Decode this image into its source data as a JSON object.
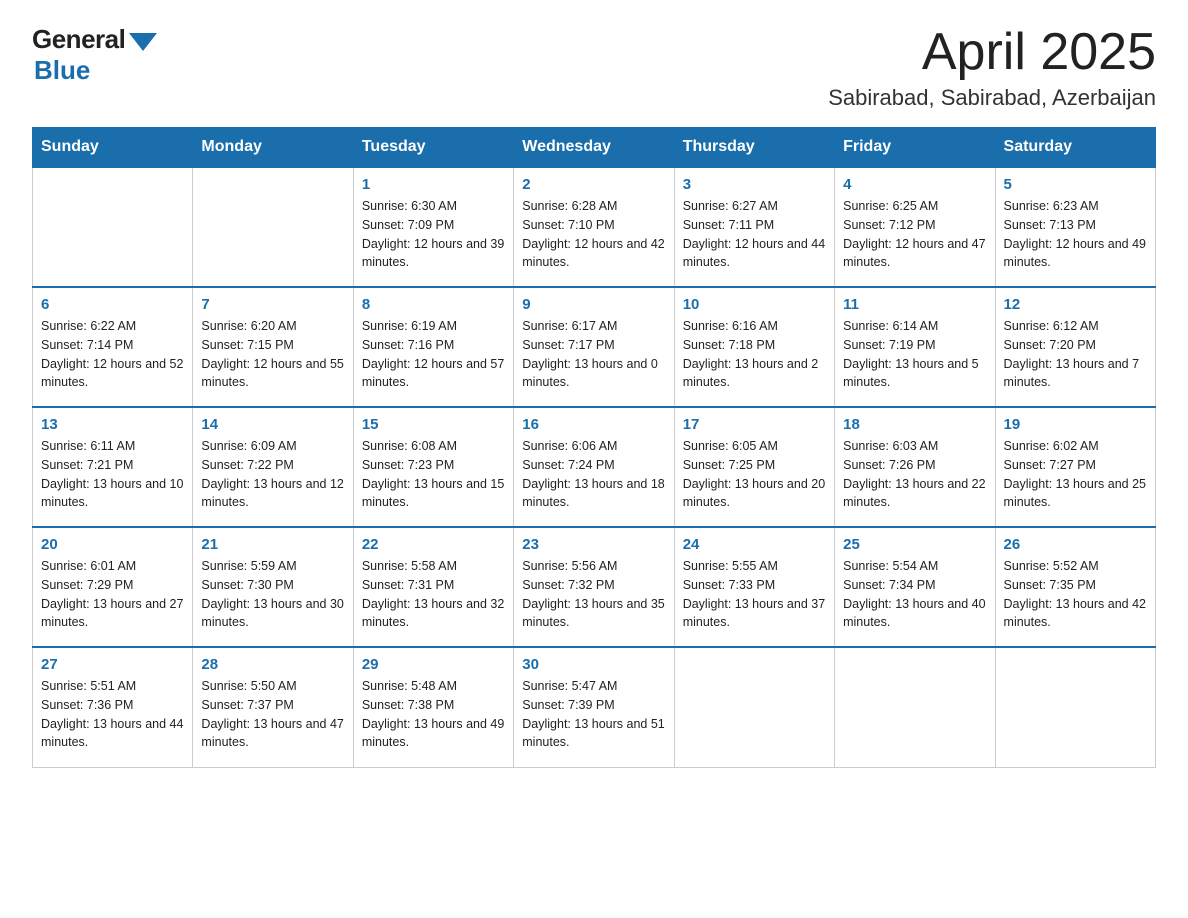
{
  "header": {
    "logo_general": "General",
    "logo_blue": "Blue",
    "month_title": "April 2025",
    "location": "Sabirabad, Sabirabad, Azerbaijan"
  },
  "weekdays": [
    "Sunday",
    "Monday",
    "Tuesday",
    "Wednesday",
    "Thursday",
    "Friday",
    "Saturday"
  ],
  "weeks": [
    [
      {
        "day": "",
        "sunrise": "",
        "sunset": "",
        "daylight": ""
      },
      {
        "day": "",
        "sunrise": "",
        "sunset": "",
        "daylight": ""
      },
      {
        "day": "1",
        "sunrise": "Sunrise: 6:30 AM",
        "sunset": "Sunset: 7:09 PM",
        "daylight": "Daylight: 12 hours and 39 minutes."
      },
      {
        "day": "2",
        "sunrise": "Sunrise: 6:28 AM",
        "sunset": "Sunset: 7:10 PM",
        "daylight": "Daylight: 12 hours and 42 minutes."
      },
      {
        "day": "3",
        "sunrise": "Sunrise: 6:27 AM",
        "sunset": "Sunset: 7:11 PM",
        "daylight": "Daylight: 12 hours and 44 minutes."
      },
      {
        "day": "4",
        "sunrise": "Sunrise: 6:25 AM",
        "sunset": "Sunset: 7:12 PM",
        "daylight": "Daylight: 12 hours and 47 minutes."
      },
      {
        "day": "5",
        "sunrise": "Sunrise: 6:23 AM",
        "sunset": "Sunset: 7:13 PM",
        "daylight": "Daylight: 12 hours and 49 minutes."
      }
    ],
    [
      {
        "day": "6",
        "sunrise": "Sunrise: 6:22 AM",
        "sunset": "Sunset: 7:14 PM",
        "daylight": "Daylight: 12 hours and 52 minutes."
      },
      {
        "day": "7",
        "sunrise": "Sunrise: 6:20 AM",
        "sunset": "Sunset: 7:15 PM",
        "daylight": "Daylight: 12 hours and 55 minutes."
      },
      {
        "day": "8",
        "sunrise": "Sunrise: 6:19 AM",
        "sunset": "Sunset: 7:16 PM",
        "daylight": "Daylight: 12 hours and 57 minutes."
      },
      {
        "day": "9",
        "sunrise": "Sunrise: 6:17 AM",
        "sunset": "Sunset: 7:17 PM",
        "daylight": "Daylight: 13 hours and 0 minutes."
      },
      {
        "day": "10",
        "sunrise": "Sunrise: 6:16 AM",
        "sunset": "Sunset: 7:18 PM",
        "daylight": "Daylight: 13 hours and 2 minutes."
      },
      {
        "day": "11",
        "sunrise": "Sunrise: 6:14 AM",
        "sunset": "Sunset: 7:19 PM",
        "daylight": "Daylight: 13 hours and 5 minutes."
      },
      {
        "day": "12",
        "sunrise": "Sunrise: 6:12 AM",
        "sunset": "Sunset: 7:20 PM",
        "daylight": "Daylight: 13 hours and 7 minutes."
      }
    ],
    [
      {
        "day": "13",
        "sunrise": "Sunrise: 6:11 AM",
        "sunset": "Sunset: 7:21 PM",
        "daylight": "Daylight: 13 hours and 10 minutes."
      },
      {
        "day": "14",
        "sunrise": "Sunrise: 6:09 AM",
        "sunset": "Sunset: 7:22 PM",
        "daylight": "Daylight: 13 hours and 12 minutes."
      },
      {
        "day": "15",
        "sunrise": "Sunrise: 6:08 AM",
        "sunset": "Sunset: 7:23 PM",
        "daylight": "Daylight: 13 hours and 15 minutes."
      },
      {
        "day": "16",
        "sunrise": "Sunrise: 6:06 AM",
        "sunset": "Sunset: 7:24 PM",
        "daylight": "Daylight: 13 hours and 18 minutes."
      },
      {
        "day": "17",
        "sunrise": "Sunrise: 6:05 AM",
        "sunset": "Sunset: 7:25 PM",
        "daylight": "Daylight: 13 hours and 20 minutes."
      },
      {
        "day": "18",
        "sunrise": "Sunrise: 6:03 AM",
        "sunset": "Sunset: 7:26 PM",
        "daylight": "Daylight: 13 hours and 22 minutes."
      },
      {
        "day": "19",
        "sunrise": "Sunrise: 6:02 AM",
        "sunset": "Sunset: 7:27 PM",
        "daylight": "Daylight: 13 hours and 25 minutes."
      }
    ],
    [
      {
        "day": "20",
        "sunrise": "Sunrise: 6:01 AM",
        "sunset": "Sunset: 7:29 PM",
        "daylight": "Daylight: 13 hours and 27 minutes."
      },
      {
        "day": "21",
        "sunrise": "Sunrise: 5:59 AM",
        "sunset": "Sunset: 7:30 PM",
        "daylight": "Daylight: 13 hours and 30 minutes."
      },
      {
        "day": "22",
        "sunrise": "Sunrise: 5:58 AM",
        "sunset": "Sunset: 7:31 PM",
        "daylight": "Daylight: 13 hours and 32 minutes."
      },
      {
        "day": "23",
        "sunrise": "Sunrise: 5:56 AM",
        "sunset": "Sunset: 7:32 PM",
        "daylight": "Daylight: 13 hours and 35 minutes."
      },
      {
        "day": "24",
        "sunrise": "Sunrise: 5:55 AM",
        "sunset": "Sunset: 7:33 PM",
        "daylight": "Daylight: 13 hours and 37 minutes."
      },
      {
        "day": "25",
        "sunrise": "Sunrise: 5:54 AM",
        "sunset": "Sunset: 7:34 PM",
        "daylight": "Daylight: 13 hours and 40 minutes."
      },
      {
        "day": "26",
        "sunrise": "Sunrise: 5:52 AM",
        "sunset": "Sunset: 7:35 PM",
        "daylight": "Daylight: 13 hours and 42 minutes."
      }
    ],
    [
      {
        "day": "27",
        "sunrise": "Sunrise: 5:51 AM",
        "sunset": "Sunset: 7:36 PM",
        "daylight": "Daylight: 13 hours and 44 minutes."
      },
      {
        "day": "28",
        "sunrise": "Sunrise: 5:50 AM",
        "sunset": "Sunset: 7:37 PM",
        "daylight": "Daylight: 13 hours and 47 minutes."
      },
      {
        "day": "29",
        "sunrise": "Sunrise: 5:48 AM",
        "sunset": "Sunset: 7:38 PM",
        "daylight": "Daylight: 13 hours and 49 minutes."
      },
      {
        "day": "30",
        "sunrise": "Sunrise: 5:47 AM",
        "sunset": "Sunset: 7:39 PM",
        "daylight": "Daylight: 13 hours and 51 minutes."
      },
      {
        "day": "",
        "sunrise": "",
        "sunset": "",
        "daylight": ""
      },
      {
        "day": "",
        "sunrise": "",
        "sunset": "",
        "daylight": ""
      },
      {
        "day": "",
        "sunrise": "",
        "sunset": "",
        "daylight": ""
      }
    ]
  ]
}
